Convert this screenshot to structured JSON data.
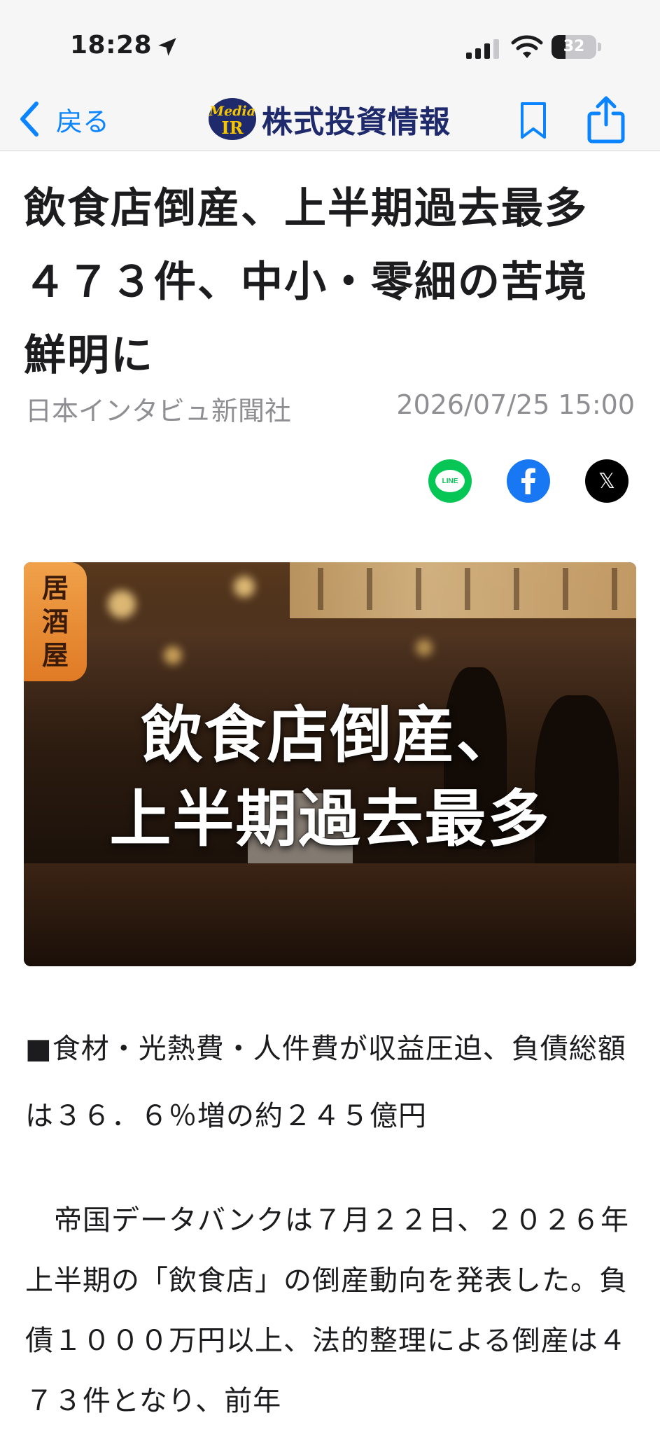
{
  "status_bar": {
    "time": "18:28",
    "battery_percent": "32",
    "battery_level": 0.32
  },
  "nav": {
    "back_label": "戻る",
    "brand_logo_text_top": "Media",
    "brand_logo_text_bottom": "IR",
    "brand_name": "株式投資情報"
  },
  "article": {
    "headline": "飲食店倒産、上半期過去最多４７３件、中小・零細の苦境鮮明に",
    "source": "日本インタビュ新聞社",
    "date": "2026/07/25 15:00",
    "share": {
      "line_label": "LINE",
      "x_label": "𝕏"
    },
    "hero": {
      "lantern_text": [
        "居",
        "酒",
        "屋"
      ],
      "caption_line1": "飲食店倒産、",
      "caption_line2": "上半期過去最多"
    },
    "subhead": "■食材・光熱費・人件費が収益圧迫、負債総額は３６．６％増の約２４５億円",
    "body": "　帝国データバンクは７月２２日、２０２６年上半期の「飲食店」の倒産動向を発表した。負債１０００万円以上、法的整理による倒産は４７３件となり、前年"
  },
  "colors": {
    "ios_blue": "#0a84ff",
    "brand_navy": "#1e2a6b",
    "line_green": "#06c755",
    "facebook_blue": "#1877f2",
    "x_black": "#000000",
    "meta_gray": "#8e8e93"
  }
}
